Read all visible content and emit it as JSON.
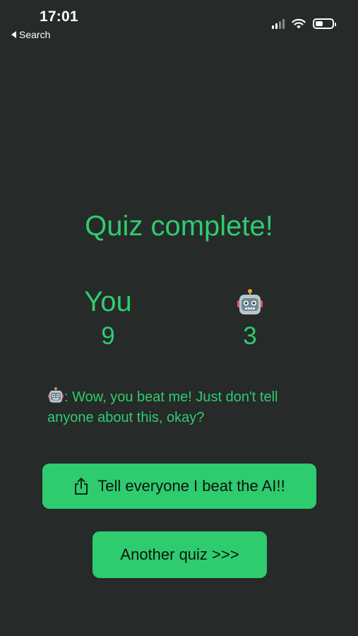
{
  "status_bar": {
    "time": "17:01",
    "back_label": "Search",
    "signal_icon": "cellular-signal-icon",
    "wifi_icon": "wifi-icon",
    "battery_icon": "battery-icon",
    "battery_level": 0.45
  },
  "quiz": {
    "title": "Quiz complete!",
    "player": {
      "label": "You",
      "score": "9"
    },
    "ai": {
      "icon": "robot-icon",
      "score": "3"
    },
    "message": ": Wow, you beat me! Just don't tell anyone about this, okay?"
  },
  "actions": {
    "share_icon": "share-icon",
    "share_label": "Tell everyone I beat the AI!!",
    "another_label": "Another quiz >>>"
  },
  "colors": {
    "background": "#262a29",
    "accent": "#2ecc6f",
    "button_text": "#0b140e"
  }
}
